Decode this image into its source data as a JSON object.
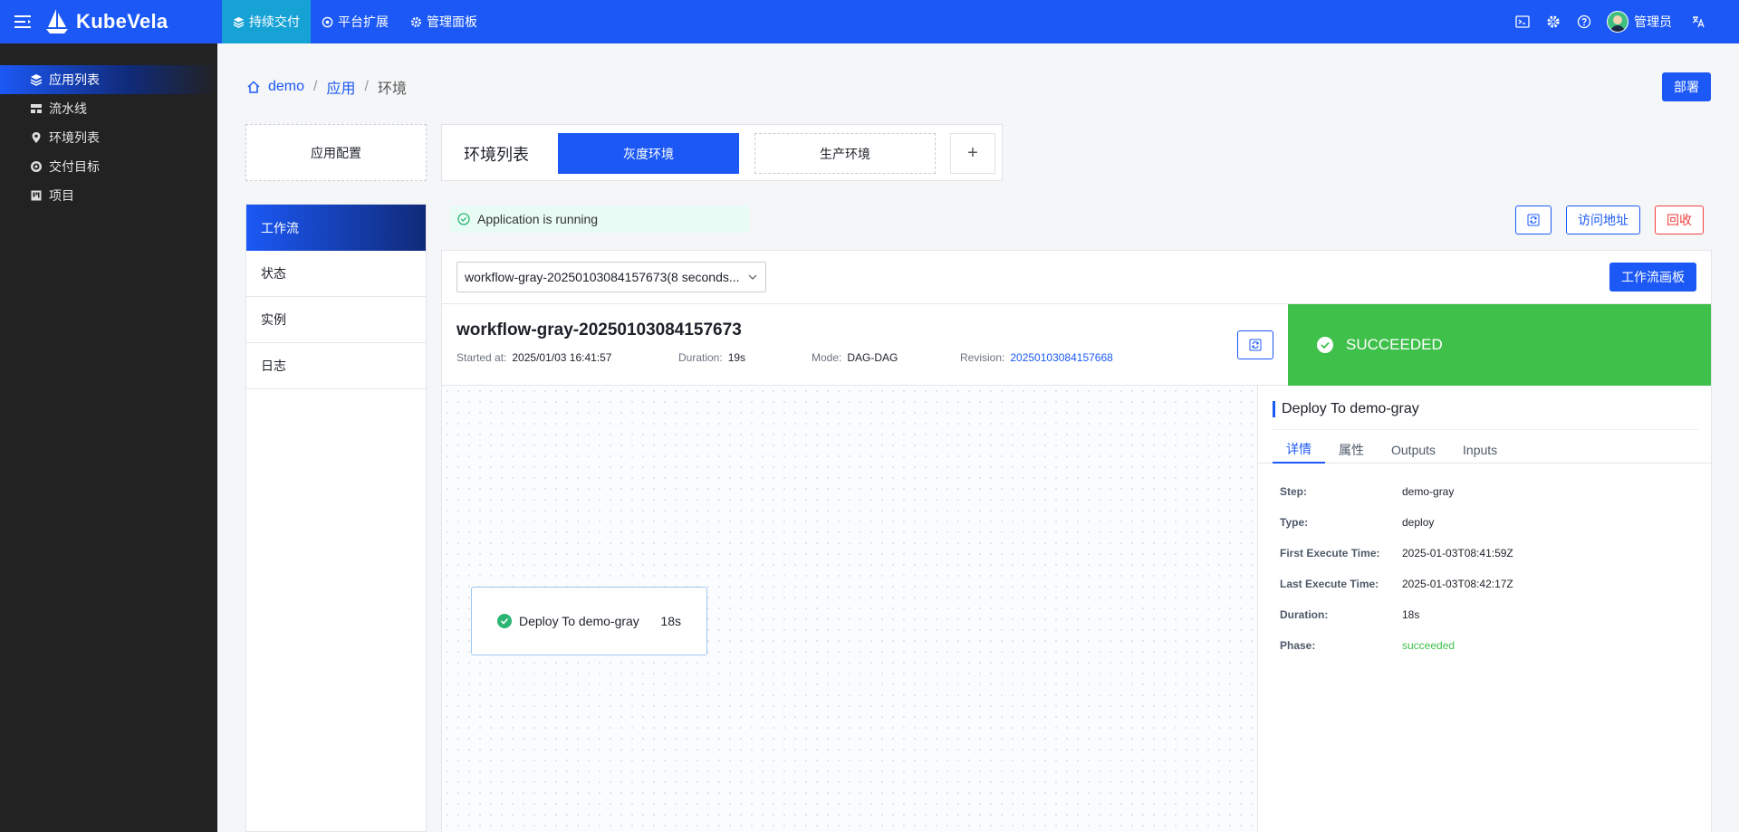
{
  "header": {
    "logo_text": "KubeVela",
    "nav": [
      {
        "label": "持续交付"
      },
      {
        "label": "平台扩展"
      },
      {
        "label": "管理面板"
      }
    ],
    "user_name": "管理员"
  },
  "sidebar": {
    "items": [
      {
        "label": "应用列表"
      },
      {
        "label": "流水线"
      },
      {
        "label": "环境列表"
      },
      {
        "label": "交付目标"
      },
      {
        "label": "项目"
      }
    ]
  },
  "breadcrumb": {
    "items": [
      "demo",
      "应用",
      "环境"
    ]
  },
  "deploy_label": "部署",
  "app_config_label": "应用配置",
  "env": {
    "title": "环境列表",
    "tabs": [
      "灰度环境",
      "生产环境"
    ],
    "add_label": "+"
  },
  "left_tabs": [
    "工作流",
    "状态",
    "实例",
    "日志"
  ],
  "status_text": "Application is running",
  "actions": {
    "visit_label": "访问地址",
    "recycle_label": "回收"
  },
  "workflow": {
    "selected": "workflow-gray-20250103084157673(8 seconds...",
    "canvas_button": "工作流画板",
    "name": "workflow-gray-20250103084157673",
    "meta": {
      "started_label": "Started at:",
      "started_value": "2025/01/03 16:41:57",
      "duration_label": "Duration:",
      "duration_value": "19s",
      "mode_label": "Mode:",
      "mode_value": "DAG-DAG",
      "revision_label": "Revision:",
      "revision_value": "20250103084157668"
    },
    "status": "SUCCEEDED",
    "colors": {
      "succeeded": "#3ec04a",
      "primary": "#1b58f5"
    }
  },
  "node": {
    "label": "Deploy To demo-gray",
    "duration": "18s"
  },
  "detail": {
    "title": "Deploy To demo-gray",
    "tabs": [
      "详情",
      "属性",
      "Outputs",
      "Inputs"
    ],
    "rows": [
      {
        "k": "Step:",
        "v": "demo-gray"
      },
      {
        "k": "Type:",
        "v": "deploy"
      },
      {
        "k": "First Execute Time:",
        "v": "2025-01-03T08:41:59Z"
      },
      {
        "k": "Last Execute Time:",
        "v": "2025-01-03T08:42:17Z"
      },
      {
        "k": "Duration:",
        "v": "18s"
      },
      {
        "k": "Phase:",
        "v": "succeeded"
      }
    ]
  }
}
